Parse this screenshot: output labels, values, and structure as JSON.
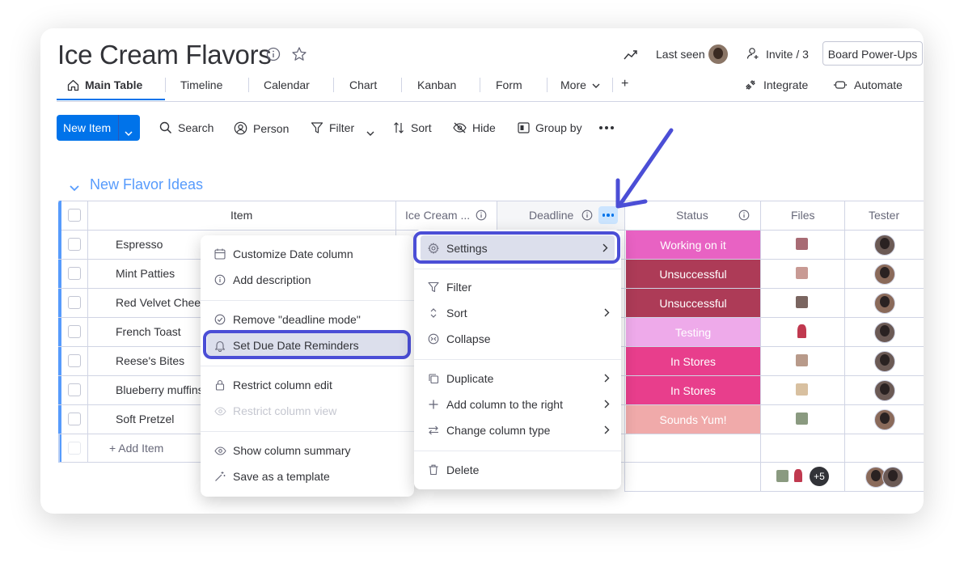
{
  "board": {
    "title": "Ice Cream Flavors"
  },
  "header": {
    "last_seen": "Last seen",
    "invite": "Invite / 3",
    "power_ups": "Board Power-Ups"
  },
  "tabs": {
    "main": "Main Table",
    "timeline": "Timeline",
    "calendar": "Calendar",
    "chart": "Chart",
    "kanban": "Kanban",
    "form": "Form",
    "more": "More",
    "add": "+",
    "integrate": "Integrate",
    "automate": "Automate"
  },
  "toolbar": {
    "new_item": "New Item",
    "search": "Search",
    "person": "Person",
    "filter": "Filter",
    "sort": "Sort",
    "hide": "Hide",
    "group_by": "Group by"
  },
  "group": {
    "title": "New Flavor Ideas",
    "color": "#579bfc"
  },
  "columns": {
    "item": "Item",
    "ice_cream": "Ice Cream ...",
    "deadline": "Deadline",
    "status": "Status",
    "files": "Files",
    "tester": "Tester"
  },
  "rows": [
    {
      "item": "Espresso",
      "status": "Working on it",
      "status_color": "#e862c3"
    },
    {
      "item": "Mint Patties",
      "status": "Unsuccessful",
      "status_color": "#ad3b57"
    },
    {
      "item": "Red Velvet Chees",
      "status": "Unsuccessful",
      "status_color": "#ad3b57"
    },
    {
      "item": "French Toast",
      "status": "Testing",
      "status_color": "#eeaaea"
    },
    {
      "item": "Reese's Bites",
      "status": "In Stores",
      "status_color": "#e83e8c"
    },
    {
      "item": "Blueberry muffins",
      "status": "In Stores",
      "status_color": "#e83e8c"
    },
    {
      "item": "Soft Pretzel",
      "status": "Sounds Yum!",
      "status_color": "#f0aaaa"
    }
  ],
  "add_item": "+ Add Item",
  "summary": {
    "files_more": "+5"
  },
  "left_menu": {
    "customize": "Customize Date column",
    "add_description": "Add description",
    "remove_deadline": "Remove \"deadline mode\"",
    "set_reminders": "Set Due Date Reminders",
    "restrict_edit": "Restrict column edit",
    "restrict_view": "Restrict column view",
    "show_summary": "Show column summary",
    "save_template": "Save as a template"
  },
  "right_menu": {
    "settings": "Settings",
    "filter": "Filter",
    "sort": "Sort",
    "collapse": "Collapse",
    "duplicate": "Duplicate",
    "add_column_right": "Add column to the right",
    "change_type": "Change column type",
    "delete": "Delete"
  },
  "colors": {
    "primary": "#0073ea",
    "highlight": "#4b4ed6",
    "group": "#579bfc"
  }
}
